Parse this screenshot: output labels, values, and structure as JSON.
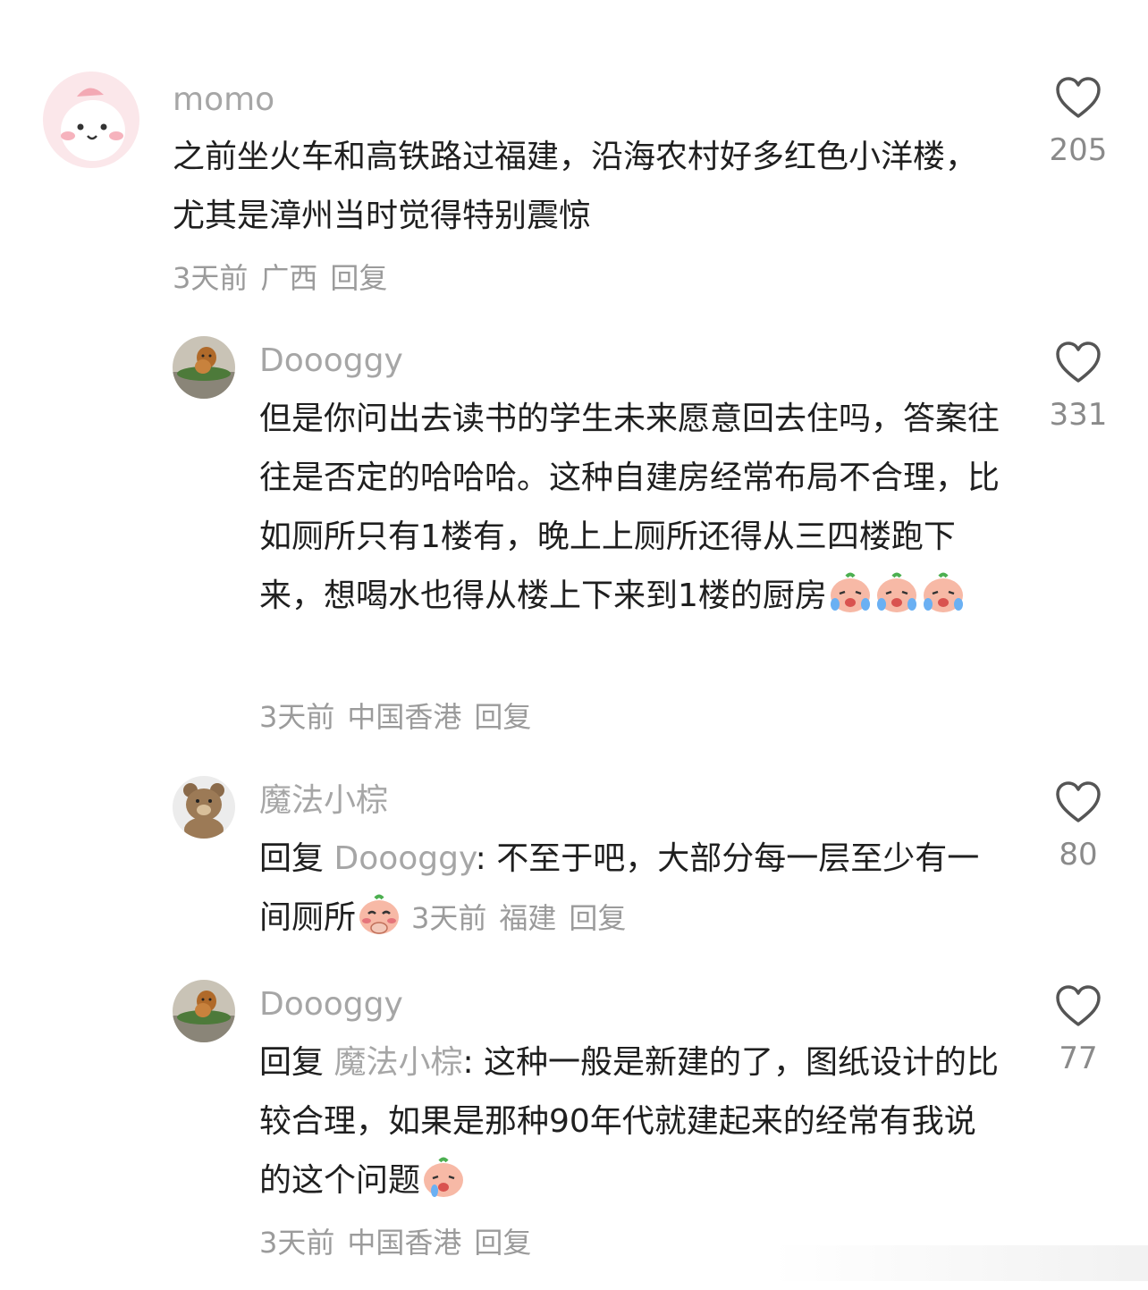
{
  "comments": [
    {
      "username": "momo",
      "text": "之前坐火车和高铁路过福建，沿海农村好多红色小洋楼，尤其是漳州当时觉得特别震惊",
      "time": "3天前",
      "location": "广西",
      "reply_label": "回复",
      "likes": "205"
    },
    {
      "username": "Doooggy",
      "text_before_emoji": "但是你问出去读书的学生未来愿意回去住吗，答案往往是否定的哈哈哈。这种自建房经常布局不合理，比如厕所只有1楼有，晚上上厕所还得从三四楼跑下来，想喝水也得从楼上下来到1楼的厨房",
      "time": "3天前",
      "location": "中国香港",
      "reply_label": "回复",
      "likes": "331"
    },
    {
      "username": "魔法小棕",
      "reply_prefix": "回复",
      "mention": "Doooggy",
      "text": ": 不至于吧，大部分每一层至少有一间厕所",
      "time": "3天前",
      "location": "福建",
      "reply_label": "回复",
      "likes": "80"
    },
    {
      "username": "Doooggy",
      "reply_prefix": "回复",
      "mention": "魔法小棕",
      "text": ": 这种一般是新建的了，图纸设计的比较合理，如果是那种90年代就建起来的经常有我说的这个问题",
      "time": "3天前",
      "location": "中国香港",
      "reply_label": "回复",
      "likes": "77"
    }
  ],
  "icons": {
    "like": "heart-outline-icon",
    "emoji_cry": "crying-peach-emoji",
    "emoji_shy": "shy-peach-emoji"
  },
  "colors": {
    "secondary_text": "#a6a6a6",
    "primary_text": "#1f1f1f"
  }
}
